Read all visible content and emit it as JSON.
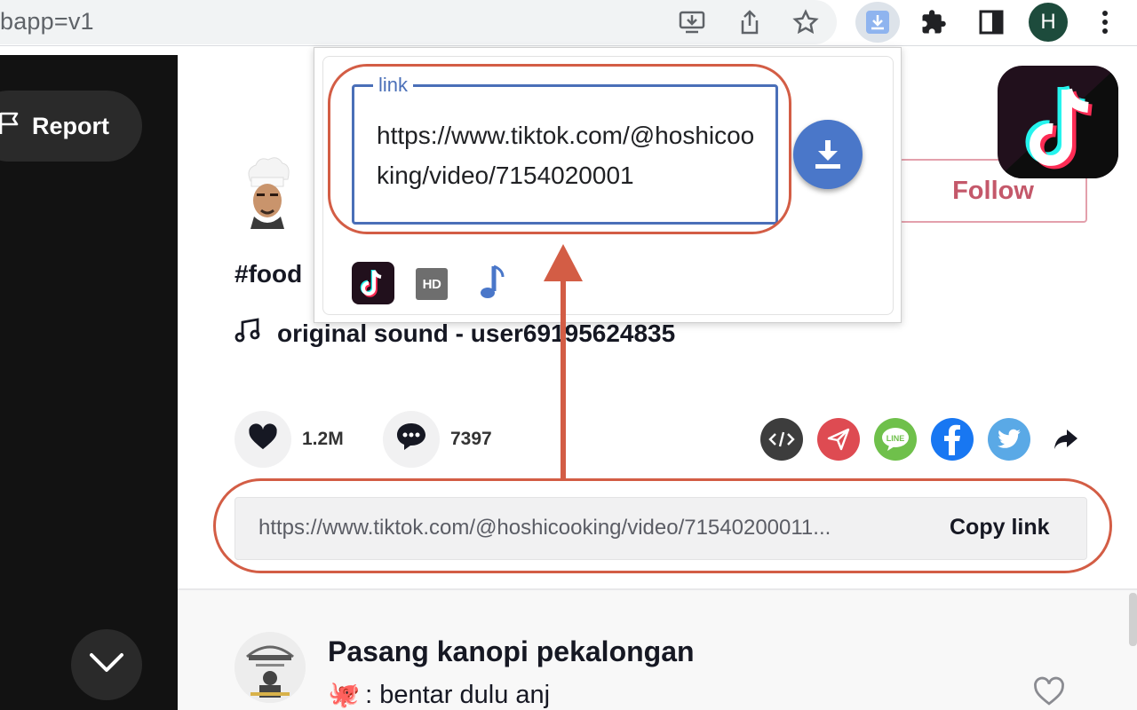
{
  "browser": {
    "url": "bapp=v1",
    "profile_initial": "H",
    "icons": [
      "install-icon",
      "share-icon",
      "star-icon",
      "download-extension-icon",
      "extensions-puzzle-icon",
      "sidebar-icon",
      "avatar",
      "more-icon"
    ]
  },
  "video_panel": {
    "report_label": "Report"
  },
  "post": {
    "follow_label": "Follow",
    "caption": "#food",
    "sound": "original sound - user69195624835",
    "likes": "1.2M",
    "comments": "7397",
    "share_targets": [
      "embed",
      "send",
      "line",
      "facebook",
      "twitter",
      "share"
    ],
    "share_colors": {
      "embed": "#3d3d3d",
      "send": "#de4b52",
      "line": "#6fc04b",
      "facebook": "#1877f2",
      "twitter": "#5aa9e6"
    },
    "link": "https://www.tiktok.com/@hoshicooking/video/71540200011...",
    "copy_label": "Copy link"
  },
  "comment": {
    "author": "Pasang kanopi pekalongan",
    "text": ": bentar dulu anj",
    "emoji": "🐙"
  },
  "popup": {
    "legend": "link",
    "value": "https://www.tiktok.com/@hoshicooking/video/7154020001",
    "options": [
      "tiktok-icon",
      "hd-icon",
      "music-note-icon"
    ],
    "hd_label": "HD"
  },
  "colors": {
    "accent_blue": "#4a6fb8",
    "annotation": "#d35d45",
    "follow": "#c4586a"
  }
}
